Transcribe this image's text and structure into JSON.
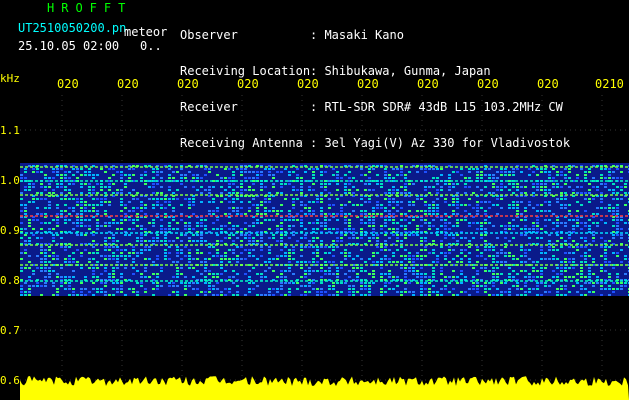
{
  "header": {
    "app_title": "HROFFT",
    "file_name": "UT2510050200.pn",
    "meteor_label": "meteor",
    "date_time": "25.10.05 02:00",
    "count": "0..",
    "info": [
      {
        "label": "Observer",
        "value": ": Masaki Kano"
      },
      {
        "label": "Receiving Location",
        "value": ": Shibukawa, Gunma, Japan"
      },
      {
        "label": "Receiver",
        "value": ": RTL-SDR SDR# 43dB L15 103.2MHz CW"
      },
      {
        "label": "Receiving Antenna",
        "value": ": 3el Yagi(V) Az 330 for Vladivostok"
      }
    ]
  },
  "axis": {
    "unit": "kHz",
    "time_ticks": [
      "020",
      "020",
      "020",
      "020",
      "020",
      "020",
      "020",
      "020",
      "020",
      "0210"
    ],
    "freq_ticks": [
      "1.1",
      "1.0",
      "0.9",
      "0.8",
      "0.7",
      "0.6"
    ]
  },
  "colors": {
    "background": "#000000",
    "title_green": "#00ff00",
    "file_cyan": "#00ffff",
    "axis_yellow": "#ffff00",
    "signal_band": "#1a3cff",
    "noise_yellow": "#ffff00"
  }
}
